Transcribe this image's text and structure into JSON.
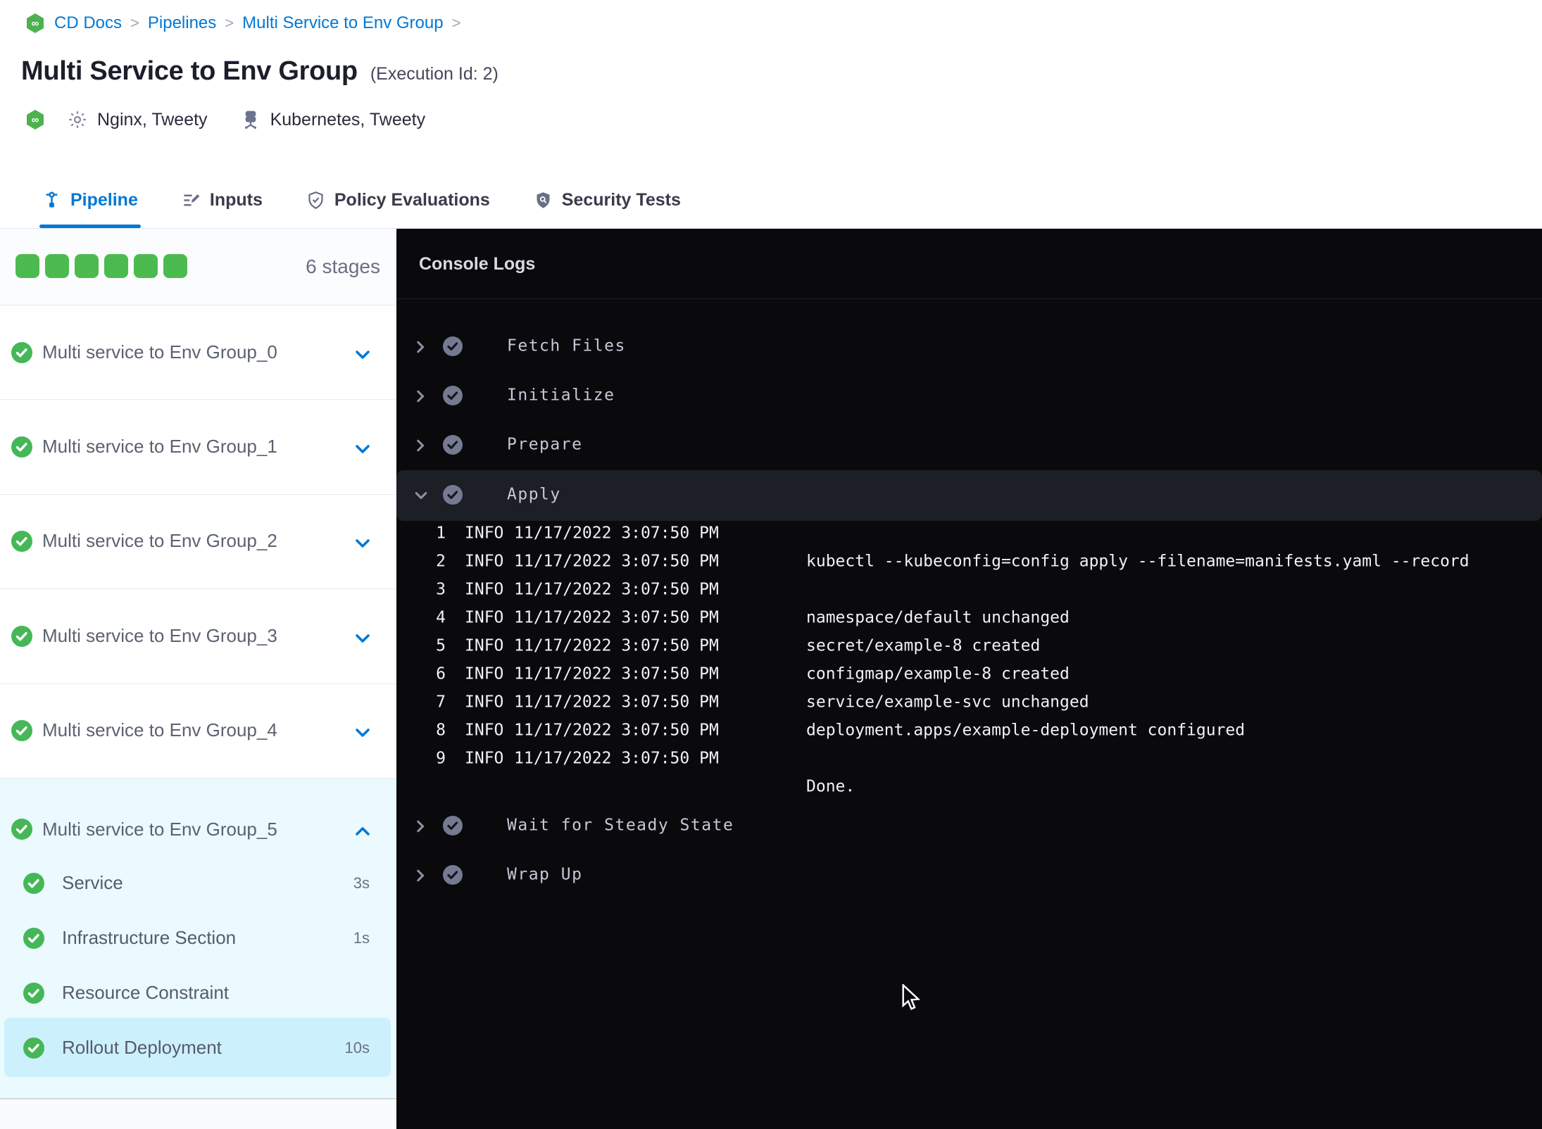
{
  "colors": {
    "blue": "#0278d5",
    "green_square": "#4cbb4f",
    "green_check": "#45b757",
    "console_bg": "#0a0a0d",
    "expanded_bg": "#eafafe",
    "selected_step_bg": "#cdf0fd"
  },
  "breadcrumb": {
    "items": [
      "CD Docs",
      "Pipelines",
      "Multi Service to Env Group"
    ],
    "separator": ">"
  },
  "header": {
    "title": "Multi Service to Env Group",
    "execution_id": "(Execution Id: 2)",
    "services_label": "Nginx, Tweety",
    "environments_label": "Kubernetes, Tweety"
  },
  "tabs": [
    {
      "label": "Pipeline",
      "icon": "pipeline-icon",
      "active": true
    },
    {
      "label": "Inputs",
      "icon": "inputs-icon",
      "active": false
    },
    {
      "label": "Policy Evaluations",
      "icon": "policy-shield-icon",
      "active": false
    },
    {
      "label": "Security Tests",
      "icon": "security-shield-icon",
      "active": false
    }
  ],
  "sidebar": {
    "squares_count": 6,
    "stages_count_label": "6 stages",
    "collapsed_stages": [
      "Multi service to Env Group_0",
      "Multi service to Env Group_1",
      "Multi service to Env Group_2",
      "Multi service to Env Group_3",
      "Multi service to Env Group_4"
    ],
    "expanded_stage": {
      "name": "Multi service to Env Group_5",
      "steps": [
        {
          "name": "Service",
          "duration": "3s",
          "selected": false
        },
        {
          "name": "Infrastructure Section",
          "duration": "1s",
          "selected": false
        },
        {
          "name": "Resource Constraint",
          "duration": "",
          "selected": false
        },
        {
          "name": "Rollout Deployment",
          "duration": "10s",
          "selected": true
        }
      ]
    }
  },
  "console": {
    "title": "Console Logs",
    "sections_before": [
      "Fetch Files",
      "Initialize",
      "Prepare"
    ],
    "expanded_section": {
      "name": "Apply",
      "logs": [
        {
          "n": "1",
          "level": "INFO",
          "ts": "11/17/2022 3:07:50 PM",
          "msg": ""
        },
        {
          "n": "2",
          "level": "INFO",
          "ts": "11/17/2022 3:07:50 PM",
          "msg": "kubectl --kubeconfig=config apply --filename=manifests.yaml --record"
        },
        {
          "n": "3",
          "level": "INFO",
          "ts": "11/17/2022 3:07:50 PM",
          "msg": ""
        },
        {
          "n": "4",
          "level": "INFO",
          "ts": "11/17/2022 3:07:50 PM",
          "msg": "namespace/default unchanged"
        },
        {
          "n": "5",
          "level": "INFO",
          "ts": "11/17/2022 3:07:50 PM",
          "msg": "secret/example-8 created"
        },
        {
          "n": "6",
          "level": "INFO",
          "ts": "11/17/2022 3:07:50 PM",
          "msg": "configmap/example-8 created"
        },
        {
          "n": "7",
          "level": "INFO",
          "ts": "11/17/2022 3:07:50 PM",
          "msg": "service/example-svc unchanged"
        },
        {
          "n": "8",
          "level": "INFO",
          "ts": "11/17/2022 3:07:50 PM",
          "msg": "deployment.apps/example-deployment configured"
        },
        {
          "n": "9",
          "level": "INFO",
          "ts": "11/17/2022 3:07:50 PM",
          "msg": ""
        }
      ],
      "trailing": "Done."
    },
    "sections_after": [
      "Wait for Steady State",
      "Wrap Up"
    ]
  }
}
